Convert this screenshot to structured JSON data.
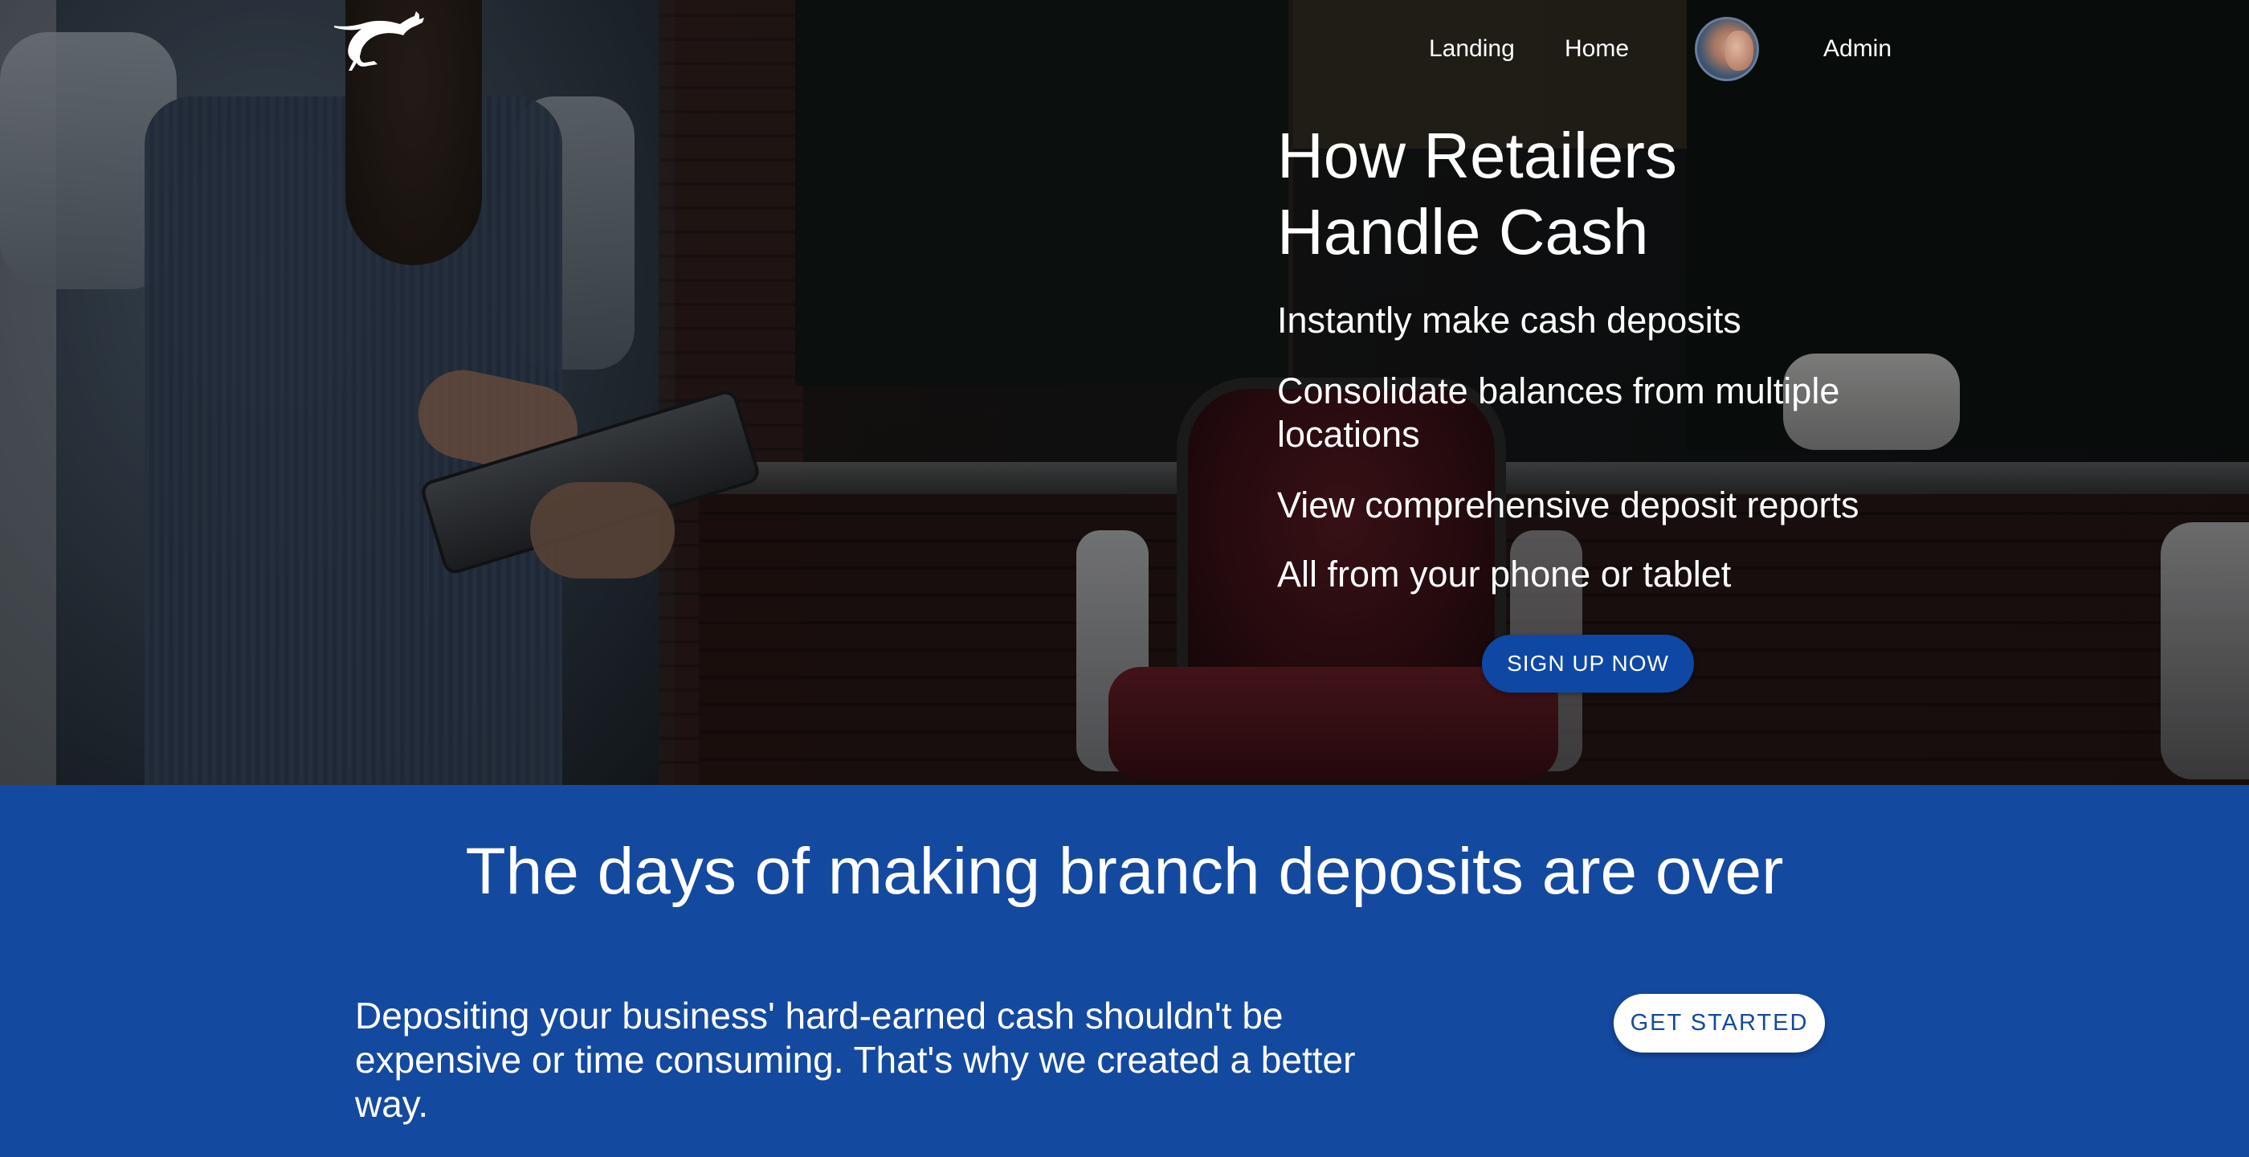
{
  "nav": {
    "landing_label": "Landing",
    "home_label": "Home",
    "admin_label": "Admin"
  },
  "logo": {
    "icon": "kangaroo-icon"
  },
  "hero": {
    "title_line1": "How Retailers",
    "title_line2": "Handle Cash",
    "lines": [
      "Instantly make cash deposits",
      "Consolidate balances from multiple locations",
      "View comprehensive deposit reports",
      "All from your phone or tablet"
    ],
    "signup_label": "SIGN UP NOW"
  },
  "band": {
    "title": "The days of making branch deposits are over",
    "text": "Depositing your business' hard-earned cash shouldn't be expensive or time consuming. That's why we created a better way.",
    "cta_label": "GET STARTED"
  },
  "colors": {
    "brand_blue": "#1449a0",
    "button_blue": "#0f47a4",
    "text_white": "#ffffff"
  }
}
